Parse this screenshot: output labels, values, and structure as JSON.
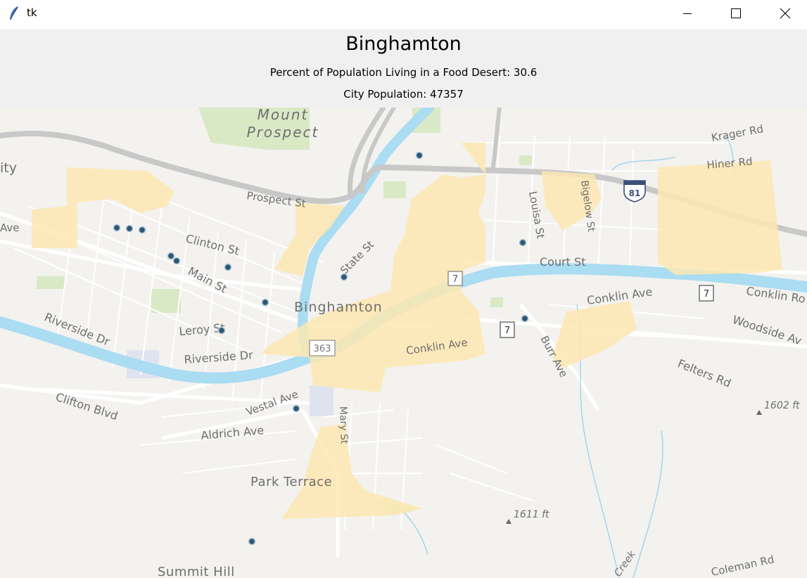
{
  "window": {
    "title": "tk",
    "icon": "feather-icon",
    "controls": {
      "minimize_icon": "minimize-icon",
      "maximize_icon": "maximize-icon",
      "close_icon": "close-icon"
    }
  },
  "header": {
    "city": "Binghamton",
    "food_desert_text": "Percent of Population Living in a Food Desert: 30.6",
    "population_text": "City Population: 47357"
  },
  "map": {
    "labels": {
      "mount": "Mount",
      "prospect": "Prospect",
      "city_fragment": "ity",
      "ave_fragment": "Ave",
      "prospect_st": "Prospect St",
      "clinton_st": "Clinton St",
      "main_st": "Main St",
      "state_st": "State St",
      "louisa_st": "Louisa St",
      "bigelow_st": "Bigelow St",
      "court_st": "Court St",
      "krager_rd": "Krager Rd",
      "hiner_rd": "Hiner Rd",
      "interstate": "81",
      "route7a": "7",
      "route7b": "7",
      "route7c": "7",
      "route363": "363",
      "binghamton": "Binghamton",
      "conklin_ave_1": "Conklin Ave",
      "conklin_ave_2": "Conklin Ave",
      "conklin_rd": "Conklin Ro",
      "woodside_ave": "Woodside Av",
      "riverside_dr_1": "Riverside Dr",
      "riverside_dr_2": "Riverside Dr",
      "leroy_st": "Leroy St",
      "burr_ave": "Burr Ave",
      "felters_rd": "Felters Rd",
      "elev_1602": "1602 ft",
      "elev_1611": "1611 ft",
      "clifton_blvd": "Clifton Blvd",
      "vestal_ave": "Vestal Ave",
      "mary_st": "Mary St",
      "aldrich_ave": "Aldrich Ave",
      "park_terrace": "Park Terrace",
      "summit_hill": "Summit Hill",
      "creek": "Creek",
      "coleman_rd": "Coleman Rd"
    },
    "colors": {
      "background": "#f3f2ef",
      "river": "#aadcf2",
      "highway": "#c9c9c9",
      "food_desert": "#fde7b2",
      "store_marker": "#2f5670",
      "park": "#d7e8c2"
    }
  }
}
